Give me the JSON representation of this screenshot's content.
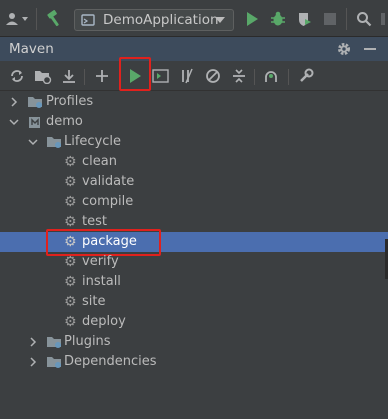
{
  "toolbar": {
    "run_config": "DemoApplication",
    "icons": [
      "user-dropdown-icon",
      "hammer-icon",
      "run-icon",
      "debug-icon",
      "coverage-icon",
      "stop-icon",
      "search-icon"
    ]
  },
  "maven": {
    "title": "Maven",
    "toolbar_icons": [
      "reload-icon",
      "reload-folder-icon",
      "download-icon",
      "add-icon",
      "run-icon",
      "execute-goal-icon",
      "toggle-offline-icon",
      "skip-tests-icon",
      "collapse-all-icon",
      "show-dependencies-icon",
      "settings-wrench-icon"
    ]
  },
  "tree": {
    "profiles": "Profiles",
    "demo": "demo",
    "lifecycle": "Lifecycle",
    "goals": [
      "clean",
      "validate",
      "compile",
      "test",
      "package",
      "verify",
      "install",
      "site",
      "deploy"
    ],
    "selected_goal": "package",
    "plugins": "Plugins",
    "dependencies": "Dependencies"
  },
  "colors": {
    "background": "#3c3f41",
    "header": "#3d4b5c",
    "selection": "#4b6eaf",
    "highlight_box": "#e0211d",
    "run_green": "#59a869"
  }
}
